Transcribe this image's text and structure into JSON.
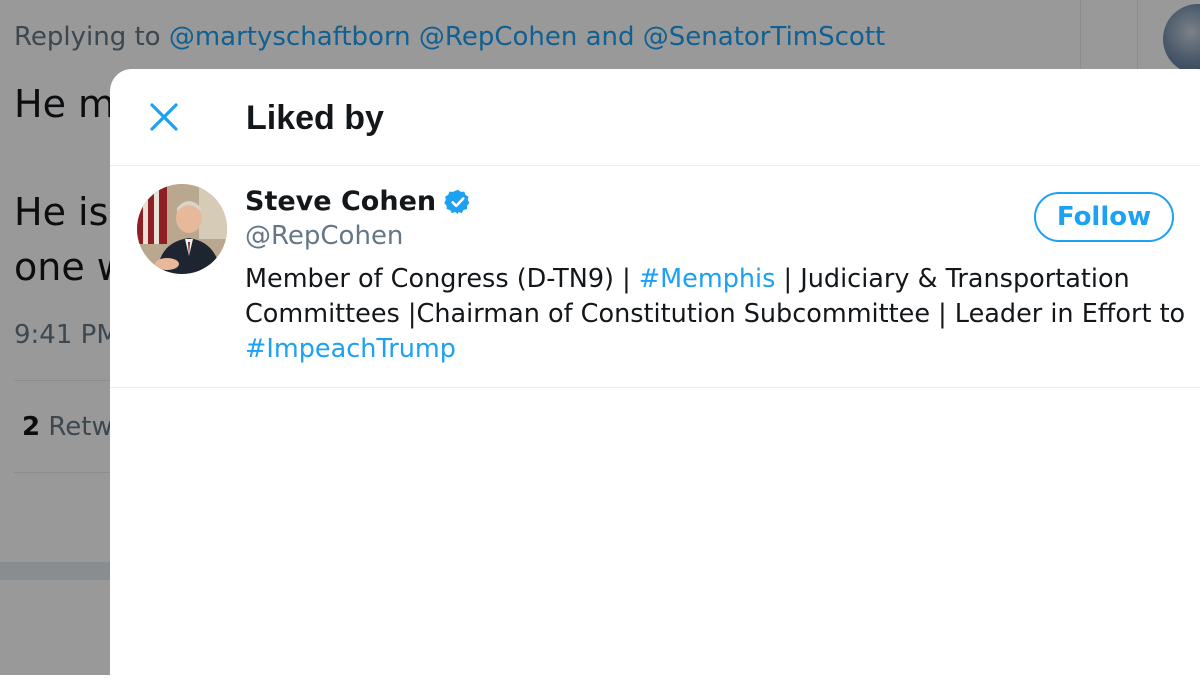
{
  "background_tweet": {
    "replying_prefix": "Replying to",
    "mention_1": "@martyschaftborn",
    "mention_2": "@RepCohen",
    "joiner": "and",
    "mention_3": "@SenatorTimScott",
    "text_line_1": "He m",
    "text_line_2": "He is",
    "text_line_3": "one w",
    "time": "9:41 PM",
    "retweets_count": "2",
    "retweets_label": "Retwe"
  },
  "modal": {
    "title": "Liked by",
    "close_icon": "close-icon",
    "users": [
      {
        "name": "Steve Cohen",
        "verified": true,
        "handle": "@RepCohen",
        "follow_label": "Follow",
        "bio_part_1": "Member of Congress (D-TN9) | ",
        "bio_hashtag_1": "#Memphis",
        "bio_part_2": " | Judiciary & Transportation Committees |Chairman of Constitution Subcommittee | Leader in Effort to ",
        "bio_hashtag_2": "#ImpeachTrump"
      }
    ]
  },
  "colors": {
    "accent": "#1da1f2",
    "text_primary": "#14171a",
    "text_secondary": "#657786",
    "divider": "#e6ecf0",
    "overlay": "rgba(0,0,0,0.4)"
  }
}
